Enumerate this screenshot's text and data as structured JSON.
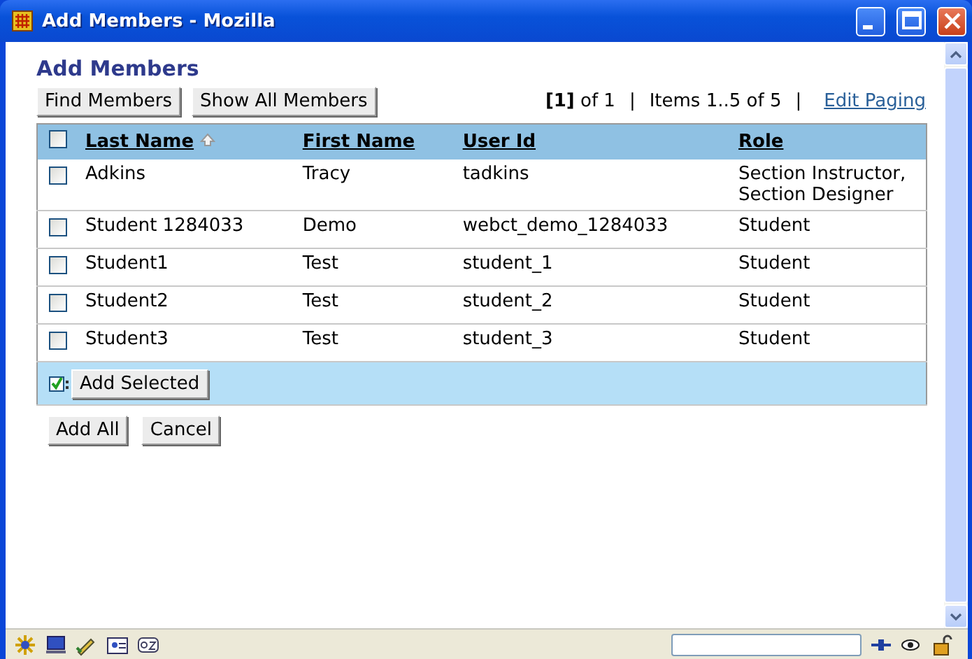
{
  "window": {
    "title": "Add Members - Mozilla"
  },
  "heading": "Add Members",
  "toolbar_buttons": [
    "Find Members",
    "Show All Members"
  ],
  "paging": {
    "page": "[1]",
    "of": "of 1",
    "separator_1": "|",
    "items": "Items 1..5 of 5",
    "separator_2": "|",
    "link": "Edit Paging"
  },
  "table": {
    "select_all": {
      "checked": false
    },
    "columns": [
      {
        "label": "Last Name",
        "sorted": true
      },
      {
        "label": "First Name",
        "sorted": false
      },
      {
        "label": "User Id",
        "sorted": false
      },
      {
        "label": "Role",
        "sorted": false
      }
    ],
    "rows": [
      {
        "checked": false,
        "cells": [
          "Adkins",
          "Tracy",
          "tadkins",
          "Section Instructor, Section Designer"
        ]
      },
      {
        "checked": false,
        "cells": [
          "Student 1284033",
          "Demo",
          "webct_demo_1284033",
          "Student"
        ]
      },
      {
        "checked": false,
        "cells": [
          "Student1",
          "Test",
          "student_1",
          "Student"
        ]
      },
      {
        "checked": false,
        "cells": [
          "Student2",
          "Test",
          "student_2",
          "Student"
        ]
      },
      {
        "checked": false,
        "cells": [
          "Student3",
          "Test",
          "student_3",
          "Student"
        ]
      }
    ],
    "footer_button": "Add Selected"
  },
  "bottom_buttons": [
    "Add All",
    "Cancel"
  ]
}
